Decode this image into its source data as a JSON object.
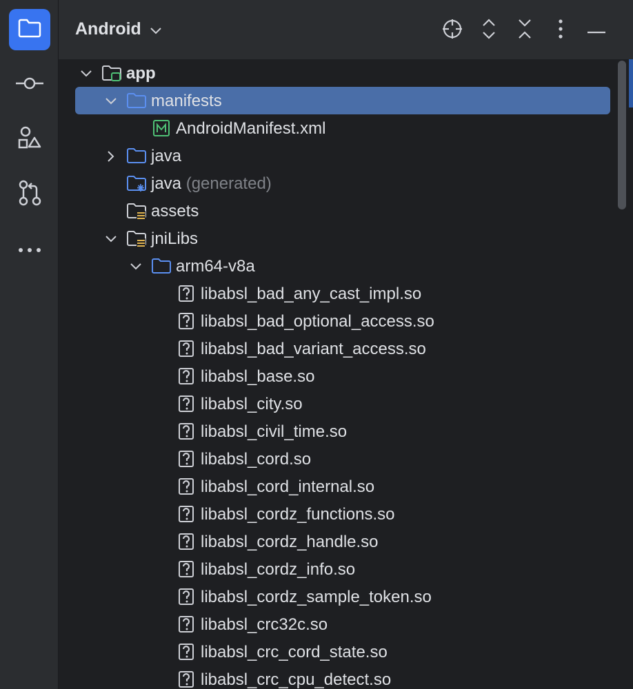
{
  "rail": {
    "items": [
      {
        "icon": "folder-icon",
        "active": true
      },
      {
        "icon": "commit-icon",
        "active": false
      },
      {
        "icon": "shapes-icon",
        "active": false
      },
      {
        "icon": "pull-request-icon",
        "active": false
      },
      {
        "icon": "more-horizontal-icon",
        "active": false
      }
    ]
  },
  "header": {
    "title": "Android",
    "actions": [
      "locate-icon",
      "expand-collapse-icon",
      "collapse-all-icon",
      "more-vertical-icon",
      "hide-icon"
    ]
  },
  "tree": {
    "rows": [
      {
        "label": "app",
        "depth": 0,
        "expand": "down",
        "icon": "module-icon",
        "bold": true
      },
      {
        "label": "manifests",
        "depth": 1,
        "expand": "down",
        "icon": "folder-icon",
        "selected": true
      },
      {
        "label": "AndroidManifest.xml",
        "depth": 2,
        "expand": "none",
        "icon": "manifest-icon"
      },
      {
        "label": "java",
        "depth": 1,
        "expand": "right",
        "icon": "source-folder-icon"
      },
      {
        "label": "java",
        "suffix": "(generated)",
        "depth": 1,
        "expand": "none",
        "icon": "generated-folder-icon"
      },
      {
        "label": "assets",
        "depth": 1,
        "expand": "none",
        "icon": "resource-folder-icon"
      },
      {
        "label": "jniLibs",
        "depth": 1,
        "expand": "down",
        "icon": "resource-folder-icon"
      },
      {
        "label": "arm64-v8a",
        "depth": 2,
        "expand": "down",
        "icon": "folder-icon"
      },
      {
        "label": "libabsl_bad_any_cast_impl.so",
        "depth": 3,
        "expand": "none",
        "icon": "unknown-file-icon"
      },
      {
        "label": "libabsl_bad_optional_access.so",
        "depth": 3,
        "expand": "none",
        "icon": "unknown-file-icon"
      },
      {
        "label": "libabsl_bad_variant_access.so",
        "depth": 3,
        "expand": "none",
        "icon": "unknown-file-icon"
      },
      {
        "label": "libabsl_base.so",
        "depth": 3,
        "expand": "none",
        "icon": "unknown-file-icon"
      },
      {
        "label": "libabsl_city.so",
        "depth": 3,
        "expand": "none",
        "icon": "unknown-file-icon"
      },
      {
        "label": "libabsl_civil_time.so",
        "depth": 3,
        "expand": "none",
        "icon": "unknown-file-icon"
      },
      {
        "label": "libabsl_cord.so",
        "depth": 3,
        "expand": "none",
        "icon": "unknown-file-icon"
      },
      {
        "label": "libabsl_cord_internal.so",
        "depth": 3,
        "expand": "none",
        "icon": "unknown-file-icon"
      },
      {
        "label": "libabsl_cordz_functions.so",
        "depth": 3,
        "expand": "none",
        "icon": "unknown-file-icon"
      },
      {
        "label": "libabsl_cordz_handle.so",
        "depth": 3,
        "expand": "none",
        "icon": "unknown-file-icon"
      },
      {
        "label": "libabsl_cordz_info.so",
        "depth": 3,
        "expand": "none",
        "icon": "unknown-file-icon"
      },
      {
        "label": "libabsl_cordz_sample_token.so",
        "depth": 3,
        "expand": "none",
        "icon": "unknown-file-icon"
      },
      {
        "label": "libabsl_crc32c.so",
        "depth": 3,
        "expand": "none",
        "icon": "unknown-file-icon"
      },
      {
        "label": "libabsl_crc_cord_state.so",
        "depth": 3,
        "expand": "none",
        "icon": "unknown-file-icon"
      },
      {
        "label": "libabsl_crc_cpu_detect.so",
        "depth": 3,
        "expand": "none",
        "icon": "unknown-file-icon"
      }
    ]
  },
  "colors": {
    "accent": "#3874f0",
    "selection": "#4a6ea8",
    "folder_blue": "#5b8ff0",
    "manifest_green": "#4fc276",
    "module_green": "#4fc276"
  }
}
